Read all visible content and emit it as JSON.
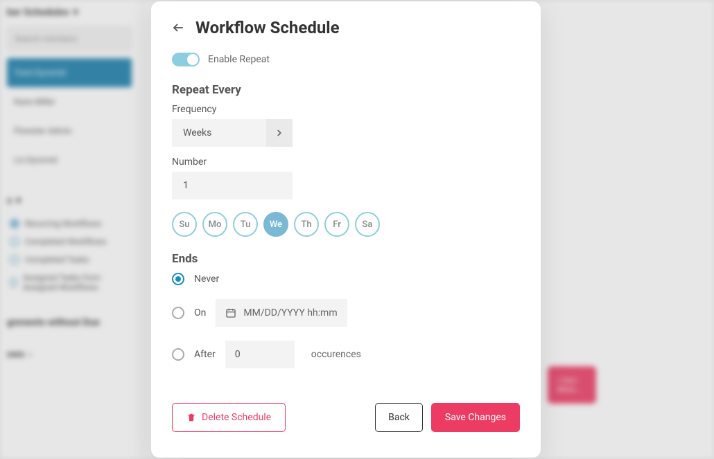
{
  "background": {
    "sidebar_heading": "ber Schedules",
    "search_placeholder": "Search members",
    "members": [
      "Trent Dyrsmid",
      "Kane Miller",
      "Flowster Admin",
      "Liz Dyrsmid"
    ],
    "filters_heading": "s",
    "filters": [
      "Recurring Workflows",
      "Completed Workflows",
      "Completed Tasks",
      "Assigned Tasks from Assigned Workflows"
    ],
    "section2": "gnments without Due",
    "section3": "ows",
    "banner": "r Own More..."
  },
  "modal": {
    "title": "Workflow Schedule",
    "enable_repeat": "Enable Repeat",
    "repeat_every": "Repeat Every",
    "frequency_label": "Frequency",
    "frequency_value": "Weeks",
    "number_label": "Number",
    "number_value": "1",
    "days": [
      {
        "label": "Su",
        "active": false
      },
      {
        "label": "Mo",
        "active": false
      },
      {
        "label": "Tu",
        "active": false
      },
      {
        "label": "We",
        "active": true
      },
      {
        "label": "Th",
        "active": false
      },
      {
        "label": "Fr",
        "active": false
      },
      {
        "label": "Sa",
        "active": false
      }
    ],
    "ends_label": "Ends",
    "ends": {
      "never": "Never",
      "on": "On",
      "on_placeholder": "MM/DD/YYYY hh:mm",
      "after": "After",
      "after_value": "0",
      "after_suffix": "occurences",
      "selected": "never"
    },
    "buttons": {
      "delete": "Delete Schedule",
      "back": "Back",
      "save": "Save Changes"
    }
  }
}
